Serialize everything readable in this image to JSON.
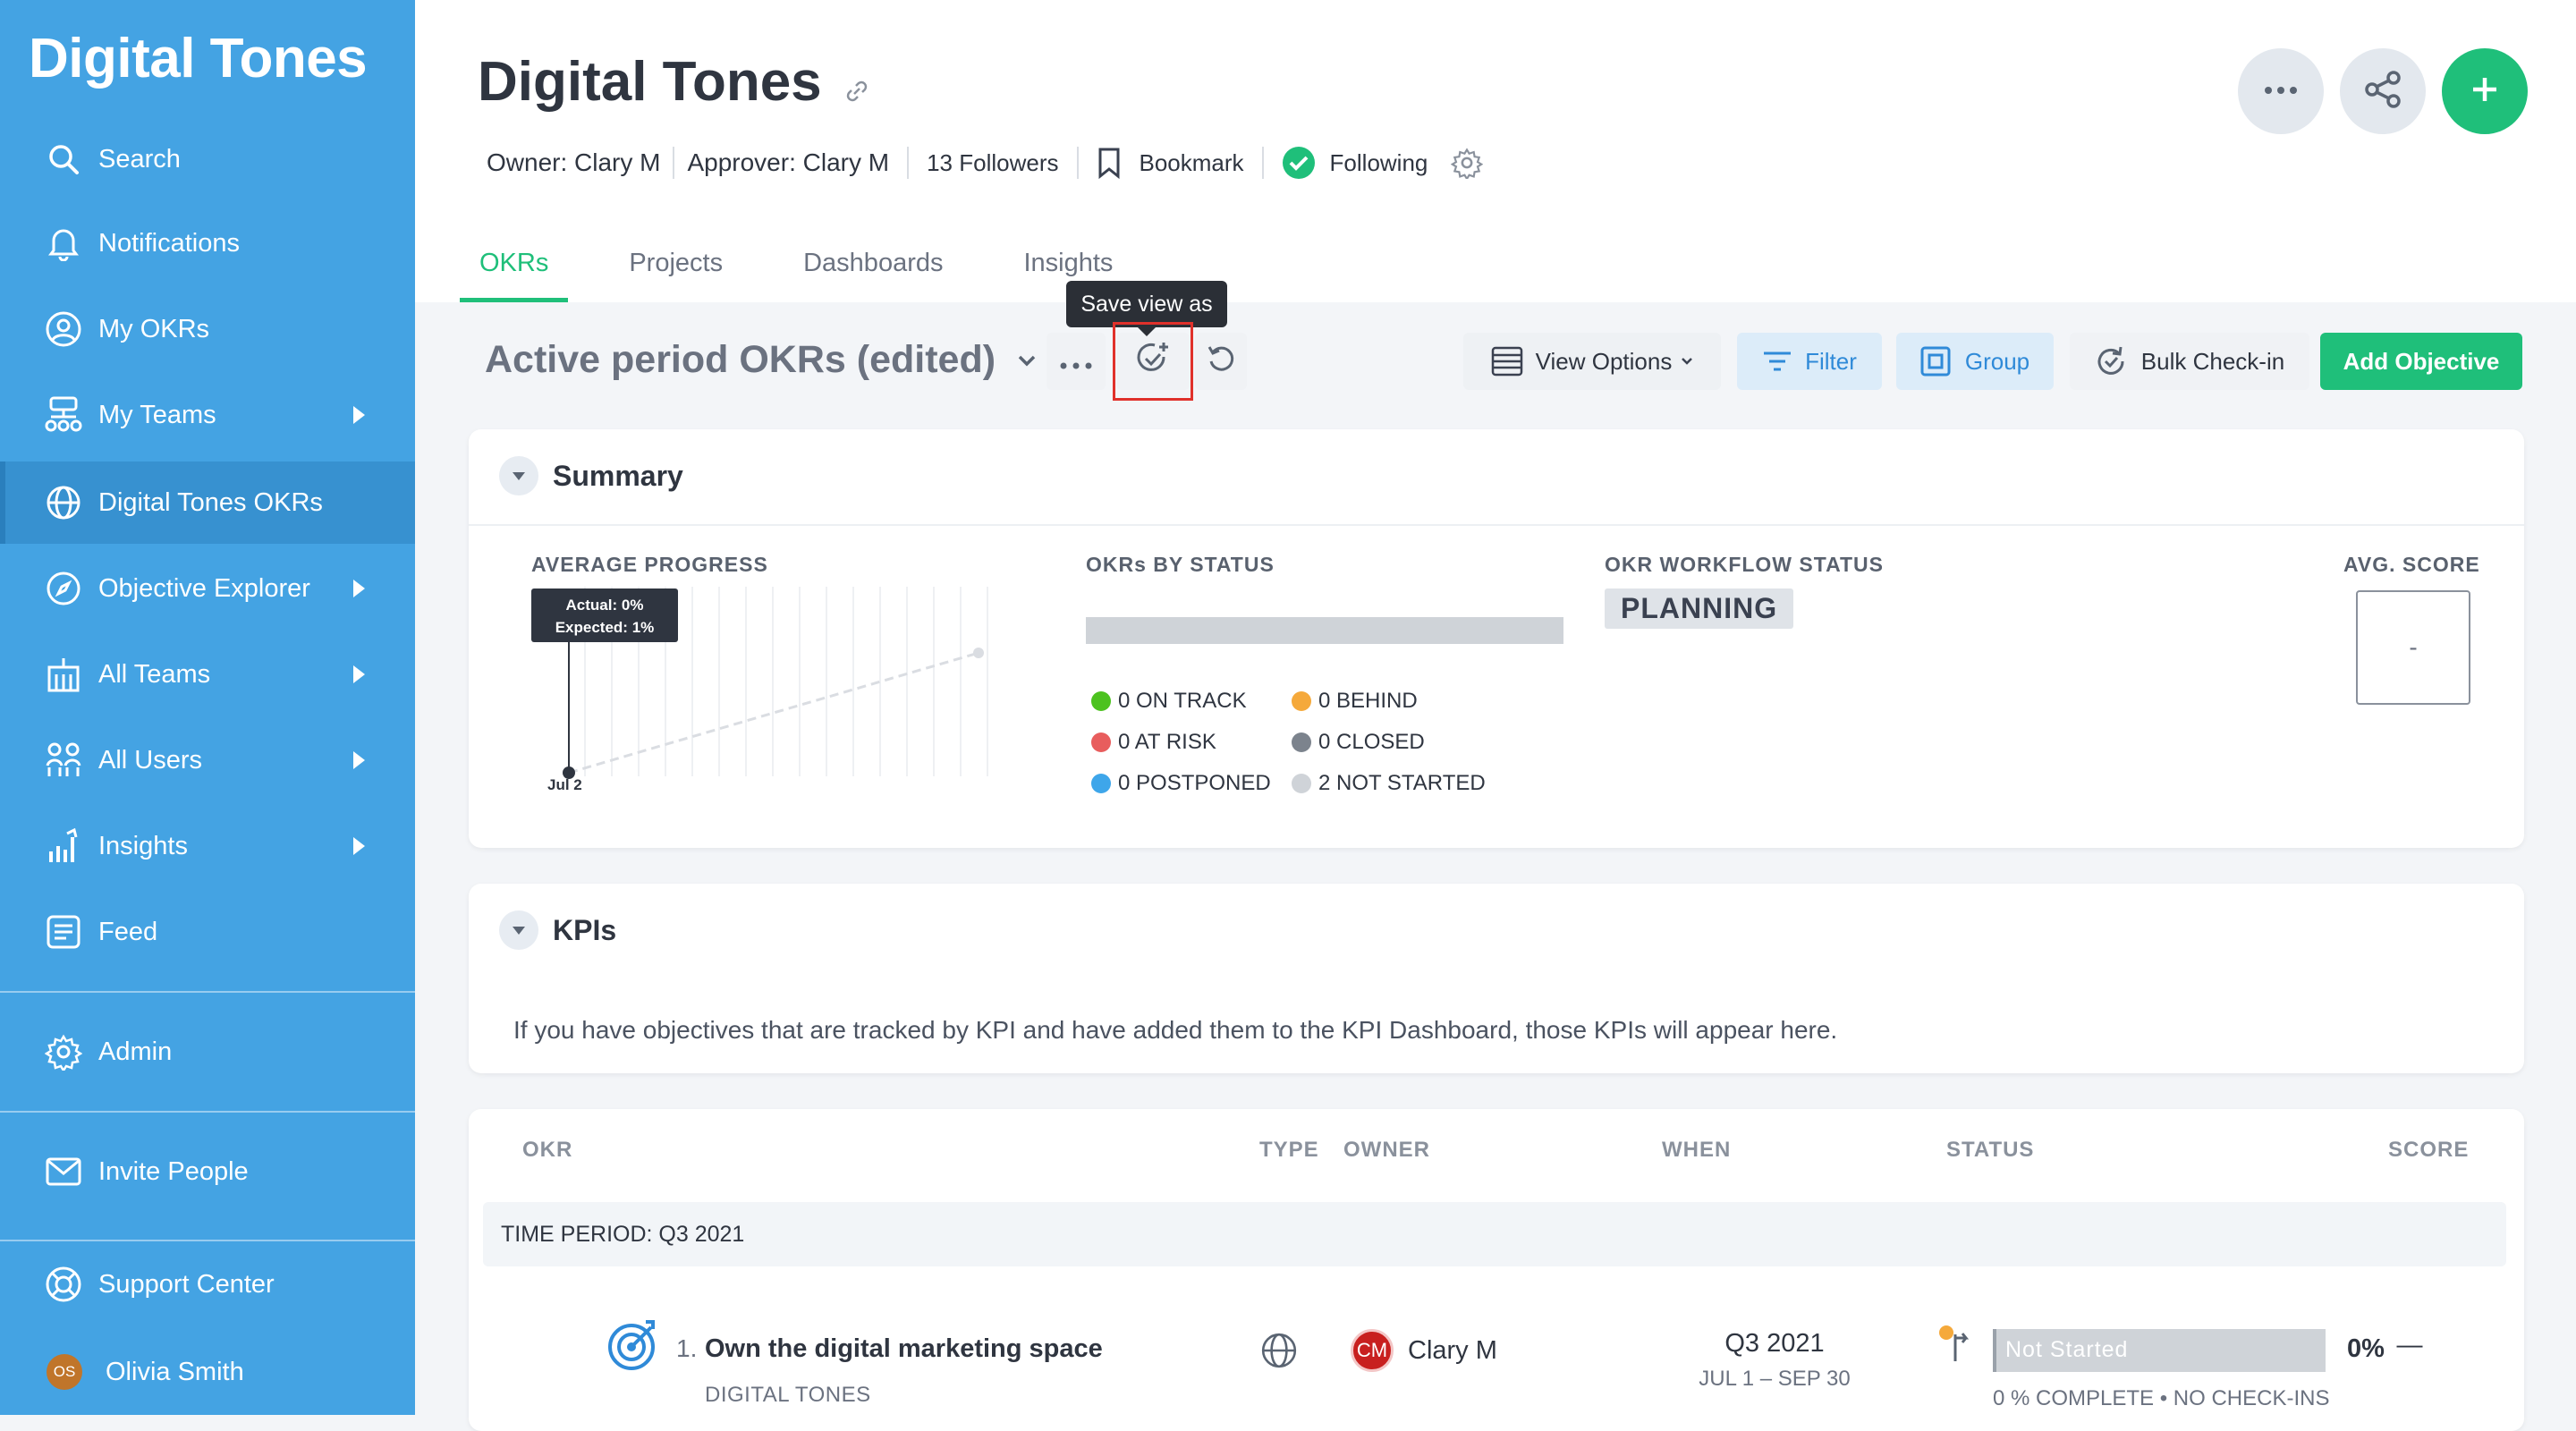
{
  "sidebar": {
    "brand": "Digital Tones",
    "items": [
      {
        "label": "Search",
        "icon": "search-icon"
      },
      {
        "label": "Notifications",
        "icon": "bell-icon"
      },
      {
        "label": "My OKRs",
        "icon": "user-circle-icon"
      },
      {
        "label": "My Teams",
        "icon": "team-tree-icon"
      },
      {
        "label": "Digital Tones OKRs",
        "icon": "globe-icon"
      },
      {
        "label": "Objective Explorer",
        "icon": "compass-icon"
      },
      {
        "label": "All Teams",
        "icon": "building-icon"
      },
      {
        "label": "All Users",
        "icon": "users-icon"
      },
      {
        "label": "Insights",
        "icon": "bar-chart-icon"
      },
      {
        "label": "Feed",
        "icon": "feed-icon"
      }
    ],
    "admin": "Admin",
    "invite": "Invite People",
    "support": "Support Center",
    "user": {
      "initials": "OS",
      "name": "Olivia Smith"
    }
  },
  "header": {
    "title": "Digital Tones",
    "owner": "Owner: Clary M",
    "approver": "Approver: Clary M",
    "followers": "13 Followers",
    "bookmark": "Bookmark",
    "following": "Following",
    "tabs": [
      "OKRs",
      "Projects",
      "Dashboards",
      "Insights"
    ],
    "accent": "#1fbf7a"
  },
  "toolbar": {
    "view_title": "Active period OKRs (edited)",
    "tooltip": "Save view as",
    "view_options": "View Options",
    "filter": "Filter",
    "group": "Group",
    "bulk_checkin": "Bulk Check-in",
    "add_objective": "Add Objective"
  },
  "summary": {
    "title": "Summary",
    "avg_progress_label": "AVERAGE PROGRESS",
    "progress_tooltip_actual": "Actual: 0%",
    "progress_tooltip_expected": "Expected: 1%",
    "chart_date": "Jul 2",
    "okrs_by_status_label": "OKRs BY STATUS",
    "statuses": [
      {
        "label": "0 ON TRACK",
        "color": "#4cc21f"
      },
      {
        "label": "0 BEHIND",
        "color": "#f5a93b"
      },
      {
        "label": "0 AT RISK",
        "color": "#e85d5d"
      },
      {
        "label": "0 CLOSED",
        "color": "#7c838d"
      },
      {
        "label": "0 POSTPONED",
        "color": "#3ea6ea"
      },
      {
        "label": "2 NOT STARTED",
        "color": "#cfd3d8"
      }
    ],
    "workflow_label": "OKR WORKFLOW STATUS",
    "workflow_value": "PLANNING",
    "avg_score_label": "AVG. SCORE",
    "avg_score_value": "-"
  },
  "kpis": {
    "title": "KPIs",
    "message": "If you have objectives that are tracked by KPI and have added them to the KPI Dashboard, those KPIs will appear here."
  },
  "table": {
    "headers": {
      "okr": "OKR",
      "type": "TYPE",
      "owner": "OWNER",
      "when": "WHEN",
      "status": "STATUS",
      "score": "SCORE"
    },
    "time_period": "TIME PERIOD: Q3 2021",
    "rows": [
      {
        "number": "1.",
        "title": "Own the digital marketing space",
        "team": "DIGITAL TONES",
        "owner_initials": "CM",
        "owner_name": "Clary M",
        "when": "Q3 2021",
        "when_range": "JUL 1 – SEP 30",
        "status": "Not Started",
        "progress_pct": "0%",
        "progress_fraction": 0,
        "progress_sub": "0 % COMPLETE • NO CHECK-INS",
        "score": "—"
      }
    ]
  }
}
